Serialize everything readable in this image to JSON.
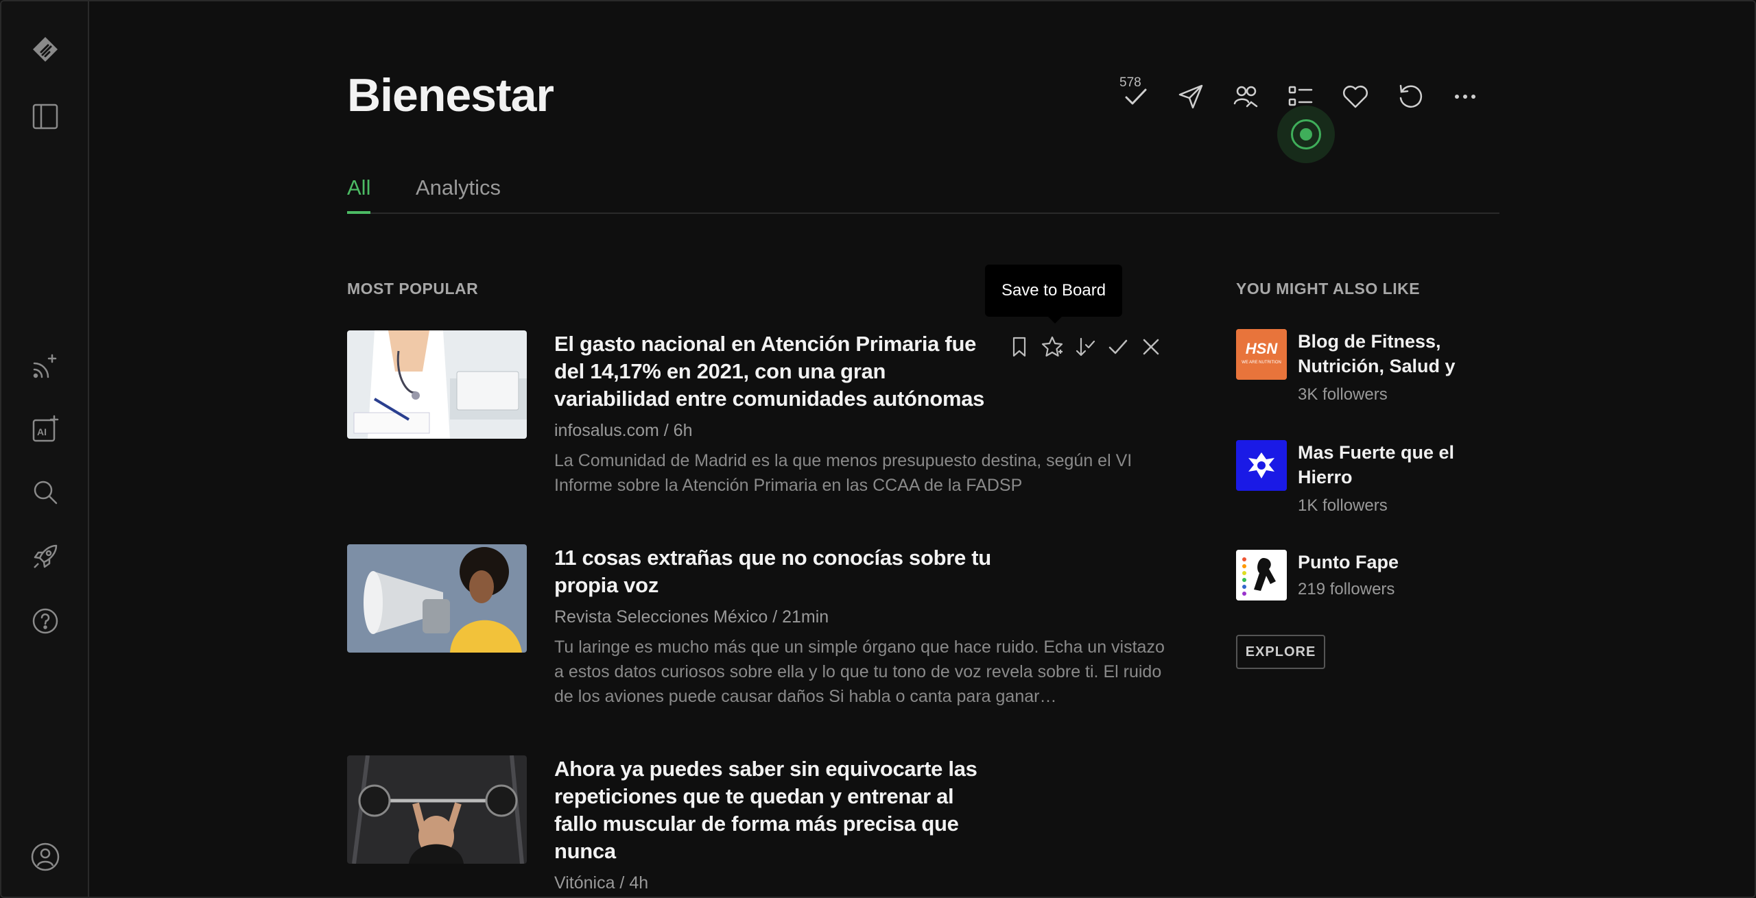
{
  "page": {
    "title": "Bienestar",
    "unread_count": "578",
    "tabs": [
      {
        "label": "All",
        "active": true
      },
      {
        "label": "Analytics",
        "active": false
      }
    ]
  },
  "toolbar_icons": [
    "check-icon",
    "send-icon",
    "share-users-icon",
    "list-icon",
    "heart-icon",
    "refresh-icon",
    "more-icon"
  ],
  "sidebar_icons": [
    "feedly-logo",
    "panel-toggle-icon",
    "add-feed-icon",
    "ai-add-icon",
    "search-icon",
    "rocket-icon",
    "help-icon",
    "profile-icon"
  ],
  "most_popular": {
    "label": "MOST POPULAR",
    "articles": [
      {
        "title": "El gasto nacional en Atención Primaria fue del 14,17% en 2021, con una gran variabilidad entre comunidades autónomas",
        "meta": "infosalus.com / 6h",
        "description": "La Comunidad de Madrid es la que menos presupuesto destina, según el VI Informe sobre la Atención Primaria en las CCAA de la FADSP"
      },
      {
        "title": "11 cosas extrañas que no conocías sobre tu propia voz",
        "meta": "Revista Selecciones México / 21min",
        "description": "Tu laringe es mucho más que un simple órgano que hace ruido. Echa un vistazo a estos datos curiosos sobre ella y lo que tu tono de voz revela sobre ti. El ruido de los aviones puede causar daños Si habla o canta para ganar…"
      },
      {
        "title": "Ahora ya puedes saber sin equivocarte las repeticiones que te quedan y entrenar al fallo muscular de forma más precisa que nunca",
        "meta": "Vitónica / 4h",
        "description": ""
      }
    ]
  },
  "tooltip": {
    "text": "Save to Board"
  },
  "suggestions": {
    "label": "YOU MIGHT ALSO LIKE",
    "items": [
      {
        "name": "Blog de Fitness, Nutrición, Salud y",
        "followers": "3K followers",
        "logo_text": "HSN",
        "logo_sub": "WE ARE NUTRITION",
        "color": "#e8743b"
      },
      {
        "name": "Mas Fuerte que el Hierro",
        "followers": "1K followers",
        "color": "#1a1ae6"
      },
      {
        "name": "Punto Fape",
        "followers": "219 followers",
        "color": "#ffffff"
      }
    ],
    "explore_label": "EXPLORE"
  },
  "accent_color": "#4cbb64"
}
